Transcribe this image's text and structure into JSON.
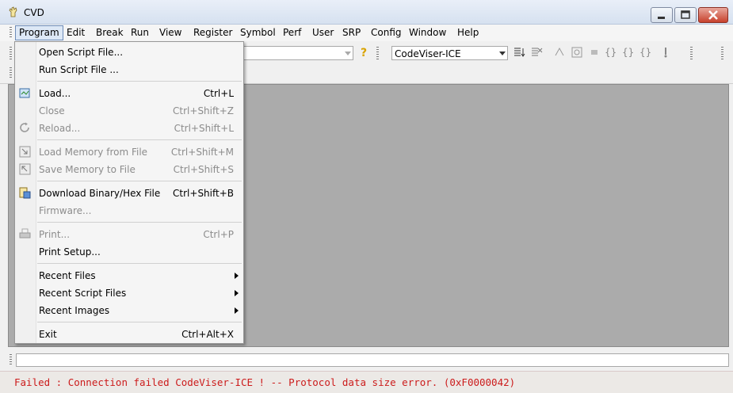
{
  "window": {
    "title": "CVD"
  },
  "menubar": {
    "items": [
      "Program",
      "Edit",
      "Break",
      "Run",
      "View",
      "Register",
      "Symbol",
      "Perf",
      "User",
      "SRP",
      "Config",
      "Window",
      "Help"
    ]
  },
  "toolbar": {
    "target_combo": {
      "value": "CodeViser-ICE"
    },
    "file_combo": {
      "value": ""
    }
  },
  "program_menu": {
    "items": [
      {
        "label": "Open Script File...",
        "shortcut": ""
      },
      {
        "label": "Run Script File ...",
        "shortcut": ""
      },
      {
        "label": "Load...",
        "shortcut": "Ctrl+L"
      },
      {
        "label": "Close",
        "shortcut": "Ctrl+Shift+Z"
      },
      {
        "label": "Reload...",
        "shortcut": "Ctrl+Shift+L"
      },
      {
        "label": "Load Memory from File",
        "shortcut": "Ctrl+Shift+M"
      },
      {
        "label": "Save Memory to File",
        "shortcut": "Ctrl+Shift+S"
      },
      {
        "label": "Download Binary/Hex File",
        "shortcut": "Ctrl+Shift+B"
      },
      {
        "label": "Firmware...",
        "shortcut": ""
      },
      {
        "label": "Print...",
        "shortcut": "Ctrl+P"
      },
      {
        "label": "Print Setup...",
        "shortcut": ""
      },
      {
        "label": "Recent Files",
        "shortcut": ""
      },
      {
        "label": "Recent Script Files",
        "shortcut": ""
      },
      {
        "label": "Recent Images",
        "shortcut": ""
      },
      {
        "label": "Exit",
        "shortcut": "Ctrl+Alt+X"
      }
    ]
  },
  "status": {
    "message": "Failed : Connection failed CodeViser-ICE ! -- Protocol data size error. (0xF0000042)",
    "error_color": "#cc1b1b"
  },
  "icons": [
    "app-icon",
    "minimize-icon",
    "maximize-icon",
    "close-icon",
    "help-icon",
    "load-icon",
    "reload-icon",
    "load-memory-icon",
    "save-memory-icon",
    "download-icon",
    "print-icon"
  ]
}
